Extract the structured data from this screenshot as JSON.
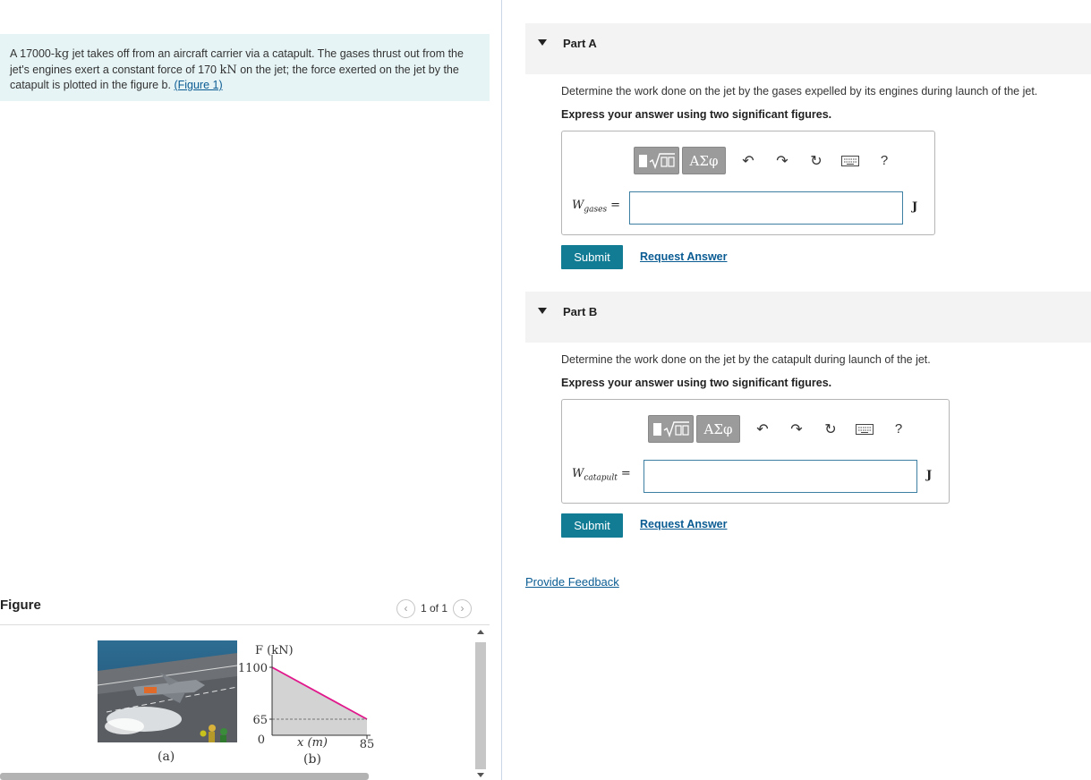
{
  "problem": {
    "text_1": "A 17000-",
    "unit_kg": "kg",
    "text_2": " jet takes off from an aircraft carrier via a catapult. The gases thrust out from the jet's engines exert a constant force of 170 ",
    "unit_kN": "kN",
    "text_3": " on the jet; the force exerted on the jet by the catapult is plotted in the figure b. ",
    "figure_link": "(Figure 1)"
  },
  "figure": {
    "title": "Figure",
    "pager": "1 of 1",
    "label_a": "(a)",
    "graph": {
      "y_axis_label": "F (kN)",
      "x_axis_label": "x (m)",
      "label_b": "(b)",
      "y_ticks": [
        "1100",
        "65",
        "0"
      ],
      "x_ticks": [
        "85"
      ],
      "points": [
        {
          "x": 0,
          "y": 1100
        },
        {
          "x": 85,
          "y": 65
        }
      ],
      "colors": {
        "line": "#e0188c",
        "fill": "#d3d3d3"
      }
    }
  },
  "parts": [
    {
      "title": "Part A",
      "question": "Determine the work done on the jet by the gases expelled by its engines during launch of the jet.",
      "instruction": "Express your answer using two significant figures.",
      "var_main": "W",
      "var_sub": "gases",
      "eq": "=",
      "unit": "J",
      "input_value": "",
      "submit_label": "Submit",
      "request_label": "Request Answer"
    },
    {
      "title": "Part B",
      "question": "Determine the work done on the jet by the catapult during launch of the jet.",
      "instruction": "Express your answer using two significant figures.",
      "var_main": "W",
      "var_sub": "catapult",
      "eq": "=",
      "unit": "J",
      "input_value": "",
      "submit_label": "Submit",
      "request_label": "Request Answer"
    }
  ],
  "toolbar": {
    "greek_label": "ΑΣφ",
    "help_label": "?",
    "icons": [
      "templates-icon",
      "greek-symbols-icon",
      "undo-icon",
      "redo-icon",
      "reset-icon",
      "keyboard-icon",
      "help-icon"
    ]
  },
  "feedback_label": "Provide Feedback",
  "colors": {
    "accent": "#137c95",
    "link": "#0a5c93",
    "problem_bg": "#e7f4f5",
    "input_border": "#3d7fa3"
  }
}
